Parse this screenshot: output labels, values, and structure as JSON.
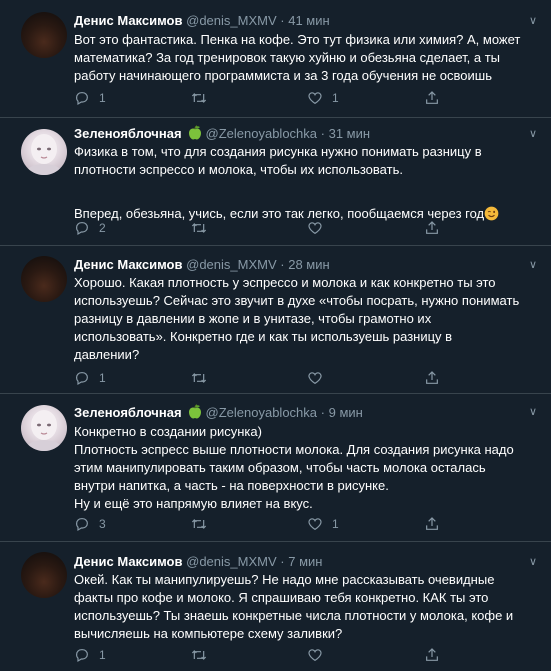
{
  "tweets": [
    {
      "name": "Денис Максимов",
      "handle": "@denis_MXMV",
      "dot": "·",
      "time": "41 мин",
      "lines": [
        "Вот это фантастика. Пенка на кофе. Это тут физика или химия? А, может",
        "математика? За год тренировок такую хуйню и обезьяна сделает, а ты",
        "работу начинающего программиста и за 3 года обучения не освоишь"
      ],
      "reply_count": "1",
      "like_count": "1"
    },
    {
      "name": "Зеленояблочная",
      "handle": "@Zelenoyablochka",
      "dot": "·",
      "time": "31 мин",
      "lines": [
        "Физика в том, что для создания рисунка нужно понимать разницу в",
        "плотности эспрессо и молока, чтобы их использовать.",
        "",
        "Вперед, обезьяна, учись, если это так легко, пообщаемся через год"
      ],
      "reply_count": "2",
      "like_count": ""
    },
    {
      "name": "Денис Максимов",
      "handle": "@denis_MXMV",
      "dot": "·",
      "time": "28 мин",
      "lines": [
        "Хорошо. Какая плотность у эспрессо и молока и как конкретно ты это",
        "используешь? Сейчас это звучит в духе «чтобы посрать, нужно понимать",
        "разницу в давлении в жопе и в унитазе, чтобы грамотно их",
        "использовать». Конкретно где и как ты используешь разницу в",
        "давлении?"
      ],
      "reply_count": "1",
      "like_count": ""
    },
    {
      "name": "Зеленояблочная",
      "handle": "@Zelenoyablochka",
      "dot": "·",
      "time": "9 мин",
      "lines": [
        "Конкретно в создании рисунка)",
        "Плотность эспресс выше плотности молока. Для создания рисунка надо",
        "этим манипулировать таким образом, чтобы часть молока осталась",
        "внутри напитка, а часть - на поверхности в рисунке.",
        "Ну и ещё это напрямую влияет на вкус."
      ],
      "reply_count": "3",
      "like_count": "1"
    },
    {
      "name": "Денис Максимов",
      "handle": "@denis_MXMV",
      "dot": "·",
      "time": "7 мин",
      "lines": [
        "Окей. Как ты манипулируешь? Не надо мне рассказывать очевидные",
        "факты про кофе и молоко. Я спрашиваю тебя конкретно. КАК ты это",
        "используешь? Ты знаешь конкретные числа плотности у молока, кофе и",
        "вычисляешь на компьютере схему заливки?"
      ],
      "reply_count": "1",
      "like_count": ""
    }
  ]
}
